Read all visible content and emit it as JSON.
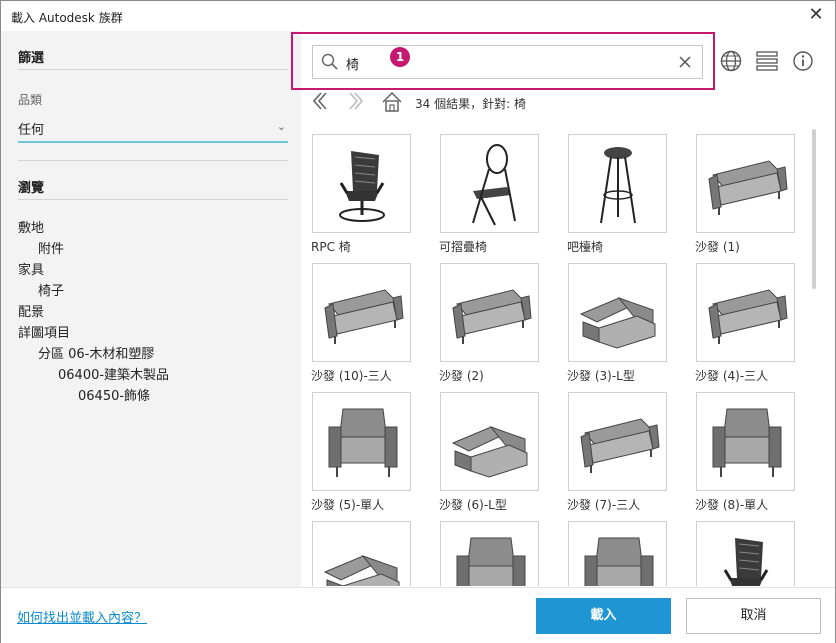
{
  "window": {
    "title": "載入 Autodesk 族群"
  },
  "filter": {
    "heading": "篩選",
    "category_label": "品類",
    "category_value": "任何"
  },
  "browse": {
    "heading": "瀏覽",
    "items": [
      {
        "label": "敷地",
        "level": 0
      },
      {
        "label": "附件",
        "level": 1
      },
      {
        "label": "家具",
        "level": 0
      },
      {
        "label": "椅子",
        "level": 1
      },
      {
        "label": "配景",
        "level": 0
      },
      {
        "label": "詳圖項目",
        "level": 0
      },
      {
        "label": "分區 06-木材和塑膠",
        "level": 1
      },
      {
        "label": "06400-建築木製品",
        "level": 2
      },
      {
        "label": "06450-飾條",
        "level": 3
      }
    ]
  },
  "search": {
    "query": "椅",
    "callout_badge": "1"
  },
  "results": {
    "summary": "34 個結果，針對: 椅",
    "items": [
      {
        "label": "RPC 椅",
        "icon": "office-chair"
      },
      {
        "label": "可摺疊椅",
        "icon": "folding-chair"
      },
      {
        "label": "吧檯椅",
        "icon": "bar-stool"
      },
      {
        "label": "沙發 (1)",
        "icon": "sofa"
      },
      {
        "label": "沙發 (10)-三人",
        "icon": "sofa"
      },
      {
        "label": "沙發 (2)",
        "icon": "sofa"
      },
      {
        "label": "沙發 (3)-L型",
        "icon": "l-sofa"
      },
      {
        "label": "沙發 (4)-三人",
        "icon": "sofa"
      },
      {
        "label": "沙發 (5)-單人",
        "icon": "armchair"
      },
      {
        "label": "沙發 (6)-L型",
        "icon": "l-sofa"
      },
      {
        "label": "沙發 (7)-三人",
        "icon": "sofa"
      },
      {
        "label": "沙發 (8)-單人",
        "icon": "armchair"
      },
      {
        "label": "",
        "icon": "l-sofa"
      },
      {
        "label": "",
        "icon": "armchair"
      },
      {
        "label": "",
        "icon": "armchair"
      },
      {
        "label": "",
        "icon": "office-chair"
      }
    ]
  },
  "footer": {
    "help_link": "如何找出並載入內容？",
    "load_button": "載入",
    "cancel_button": "取消"
  },
  "colors": {
    "accent_blue": "#1f96d3",
    "highlight_magenta": "#c4196e",
    "link_blue": "#0a8bd0"
  }
}
